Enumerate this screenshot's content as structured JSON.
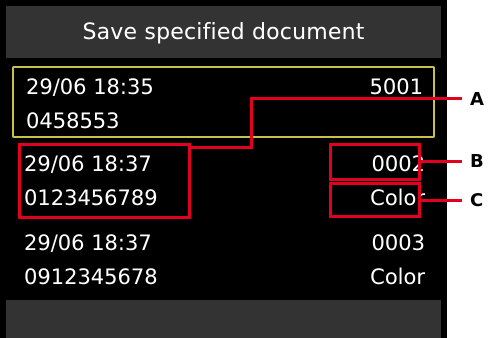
{
  "title": "Save specified document",
  "entries": [
    {
      "datetime": "29/06 18:35",
      "fax_number": "0458553",
      "ref_number": "5001",
      "color_mode": "",
      "selected": true
    },
    {
      "datetime": "29/06 18:37",
      "fax_number": "0123456789",
      "ref_number": "0002",
      "color_mode": "Color",
      "selected": false
    },
    {
      "datetime": "29/06 18:37",
      "fax_number": "0912345678",
      "ref_number": "0003",
      "color_mode": "Color",
      "selected": false
    }
  ],
  "callouts": {
    "a": "A",
    "b": "B",
    "c": "C"
  },
  "colors": {
    "screen_background": "#000000",
    "title_bar": "#333333",
    "selection_border": "#c8c24a",
    "callout_red": "#e1001f"
  }
}
